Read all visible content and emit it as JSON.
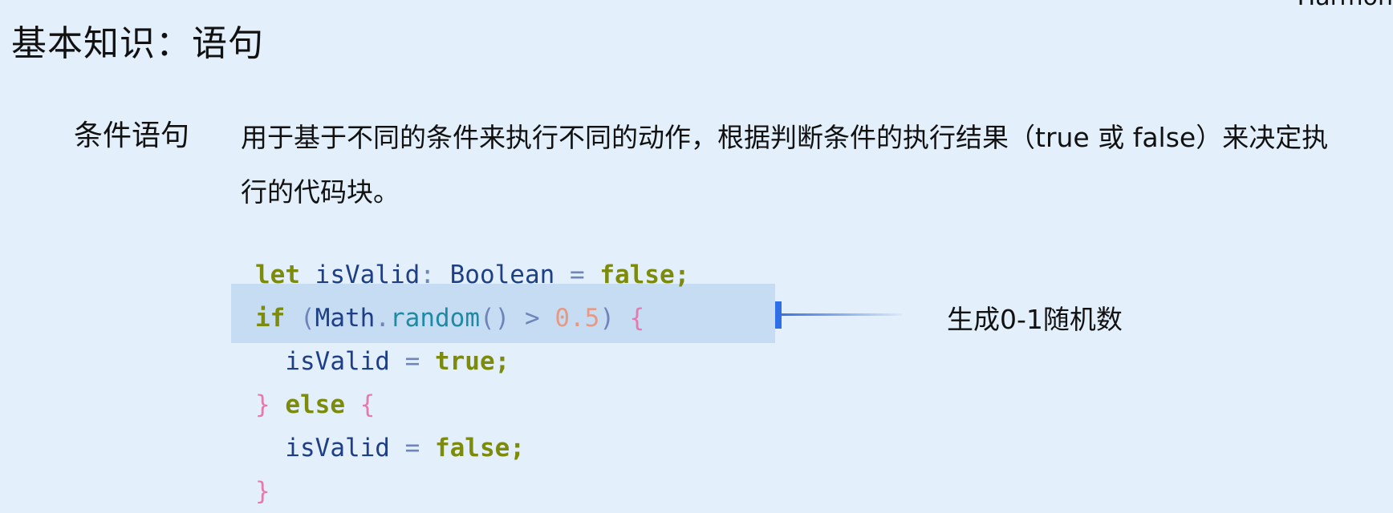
{
  "corner_text": "Harmon",
  "title": "基本知识：语句",
  "section": {
    "label": "条件语句",
    "description": "用于基于不同的条件来执行不同的动作，根据判断条件的执行结果（true 或 false）来决定执行的代码块。"
  },
  "code": {
    "lines": [
      [
        {
          "t": "let",
          "c": "kw"
        },
        {
          "t": " isValid",
          "c": "plain"
        },
        {
          "t": ":",
          "c": "punc"
        },
        {
          "t": " Boolean ",
          "c": "plain"
        },
        {
          "t": "=",
          "c": "punc"
        },
        {
          "t": " ",
          "c": "plain"
        },
        {
          "t": "false",
          "c": "kw"
        },
        {
          "t": ";",
          "c": "kw"
        }
      ],
      [
        {
          "t": "if",
          "c": "kw"
        },
        {
          "t": " ",
          "c": "plain"
        },
        {
          "t": "(",
          "c": "punc"
        },
        {
          "t": "Math",
          "c": "plain"
        },
        {
          "t": ".",
          "c": "punc"
        },
        {
          "t": "random",
          "c": "fn"
        },
        {
          "t": "()",
          "c": "punc"
        },
        {
          "t": " > ",
          "c": "punc"
        },
        {
          "t": "0.5",
          "c": "num"
        },
        {
          "t": ")",
          "c": "punc"
        },
        {
          "t": " ",
          "c": "plain"
        },
        {
          "t": "{",
          "c": "brace"
        }
      ],
      [
        {
          "t": "  isValid ",
          "c": "plain"
        },
        {
          "t": "=",
          "c": "punc"
        },
        {
          "t": " ",
          "c": "plain"
        },
        {
          "t": "true",
          "c": "kw"
        },
        {
          "t": ";",
          "c": "kw"
        }
      ],
      [
        {
          "t": "}",
          "c": "brace"
        },
        {
          "t": " ",
          "c": "plain"
        },
        {
          "t": "else",
          "c": "kw"
        },
        {
          "t": " ",
          "c": "plain"
        },
        {
          "t": "{",
          "c": "brace"
        }
      ],
      [
        {
          "t": "  isValid ",
          "c": "plain"
        },
        {
          "t": "=",
          "c": "punc"
        },
        {
          "t": " ",
          "c": "plain"
        },
        {
          "t": "false",
          "c": "kw"
        },
        {
          "t": ";",
          "c": "kw"
        }
      ],
      [
        {
          "t": "}",
          "c": "brace"
        }
      ]
    ],
    "highlighted_line": 2
  },
  "annotation": "生成0-1随机数",
  "colors": {
    "background": "#e3f0fb",
    "highlight": "#c6dcf3",
    "keyword": "#7c8b0c",
    "identifier": "#1e3f86",
    "function": "#1f8aa3",
    "number": "#e59a86",
    "brace": "#e57ab0",
    "pointer": "#2e6ee6"
  }
}
